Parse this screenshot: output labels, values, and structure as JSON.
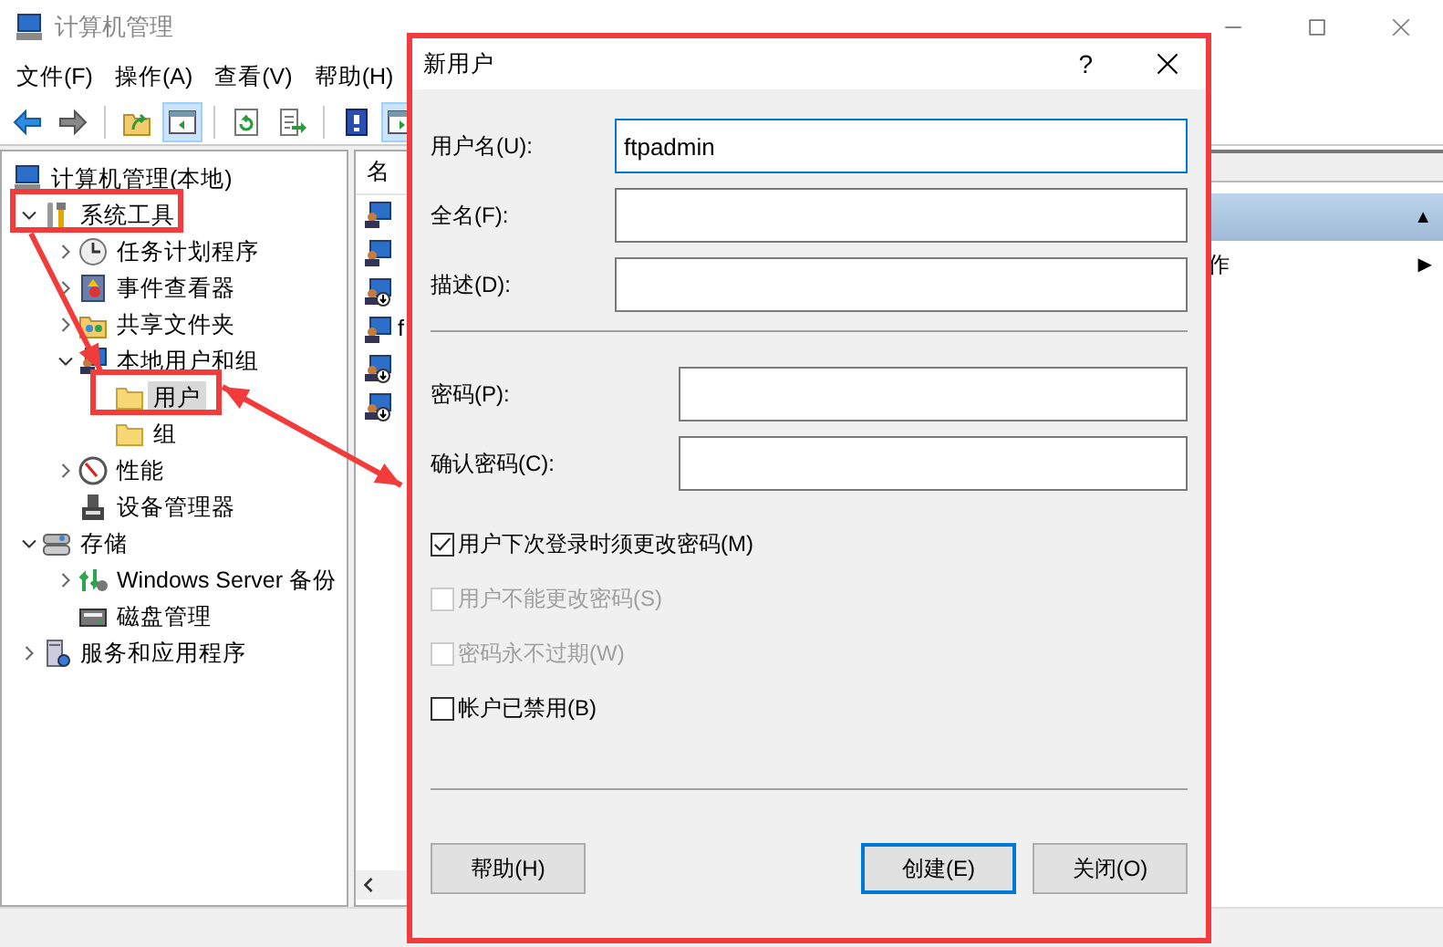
{
  "window": {
    "title": "计算机管理"
  },
  "menu": [
    {
      "label": "文件(F)"
    },
    {
      "label": "操作(A)"
    },
    {
      "label": "查看(V)"
    },
    {
      "label": "帮助(H)"
    }
  ],
  "toolbar": [
    {
      "kind": "back",
      "pressed": false
    },
    {
      "kind": "forward",
      "pressed": false
    },
    {
      "kind": "sep"
    },
    {
      "kind": "up",
      "pressed": false
    },
    {
      "kind": "tree",
      "pressed": true
    },
    {
      "kind": "sep"
    },
    {
      "kind": "refresh",
      "pressed": false
    },
    {
      "kind": "export",
      "pressed": false
    },
    {
      "kind": "sep"
    },
    {
      "kind": "help",
      "pressed": false
    },
    {
      "kind": "pane",
      "pressed": true
    }
  ],
  "tree": [
    {
      "label": "计算机管理(本地)",
      "kind": "computer",
      "selected": false,
      "children": [
        {
          "label": "系统工具",
          "kind": "tools",
          "expanded": true,
          "selected": false,
          "children": [
            {
              "label": "任务计划程序",
              "kind": "clock",
              "expanded": false,
              "selected": false
            },
            {
              "label": "事件查看器",
              "kind": "log",
              "expanded": false,
              "selected": false
            },
            {
              "label": "共享文件夹",
              "kind": "share",
              "expanded": false,
              "selected": false
            },
            {
              "label": "本地用户和组",
              "kind": "users",
              "expanded": true,
              "selected": false,
              "children": [
                {
                  "label": "用户",
                  "kind": "folder",
                  "selected": true
                },
                {
                  "label": "组",
                  "kind": "folder",
                  "selected": false
                }
              ]
            },
            {
              "label": "性能",
              "kind": "perf",
              "expanded": false,
              "selected": false
            },
            {
              "label": "设备管理器",
              "kind": "device",
              "selected": false
            }
          ]
        },
        {
          "label": "存储",
          "kind": "storage",
          "expanded": true,
          "selected": false,
          "children": [
            {
              "label": "Windows Server 备份",
              "kind": "backup",
              "expanded": false,
              "selected": false
            },
            {
              "label": "磁盘管理",
              "kind": "disk",
              "selected": false
            }
          ]
        },
        {
          "label": "服务和应用程序",
          "kind": "services",
          "expanded": false,
          "selected": false
        }
      ]
    }
  ],
  "list": {
    "column": "名",
    "items": [
      {
        "disabled": false
      },
      {
        "disabled": false
      },
      {
        "disabled": true
      },
      {
        "label": "f",
        "disabled": false
      },
      {
        "disabled": true
      },
      {
        "disabled": true
      }
    ]
  },
  "actions": {
    "section_arrow": "▲",
    "item": {
      "label": "作",
      "arrow": "▶"
    }
  },
  "dialog": {
    "title": "新用户",
    "help": "?",
    "fields": [
      {
        "label": "用户名(U):",
        "value": "ftpadmin",
        "focused": true
      },
      {
        "label": "全名(F):",
        "focused": false
      },
      {
        "label": "描述(D):",
        "focused": false
      }
    ],
    "password_fields": [
      {
        "label": "密码(P):",
        "focused": false
      },
      {
        "label": "确认密码(C):",
        "focused": false
      }
    ],
    "options": [
      {
        "label": "用户下次登录时须更改密码(M)",
        "checked": true,
        "disabled": false
      },
      {
        "label": "用户不能更改密码(S)",
        "checked": false,
        "disabled": true
      },
      {
        "label": "密码永不过期(W)",
        "checked": false,
        "disabled": true
      },
      {
        "label": "帐户已禁用(B)",
        "checked": false,
        "disabled": false
      }
    ],
    "buttons": [
      {
        "label": "帮助(H)",
        "kind": "left",
        "default": false
      },
      {
        "label": "创建(E)",
        "kind": "right",
        "default": true
      },
      {
        "label": "关闭(O)",
        "kind": "right",
        "default": false
      }
    ]
  }
}
